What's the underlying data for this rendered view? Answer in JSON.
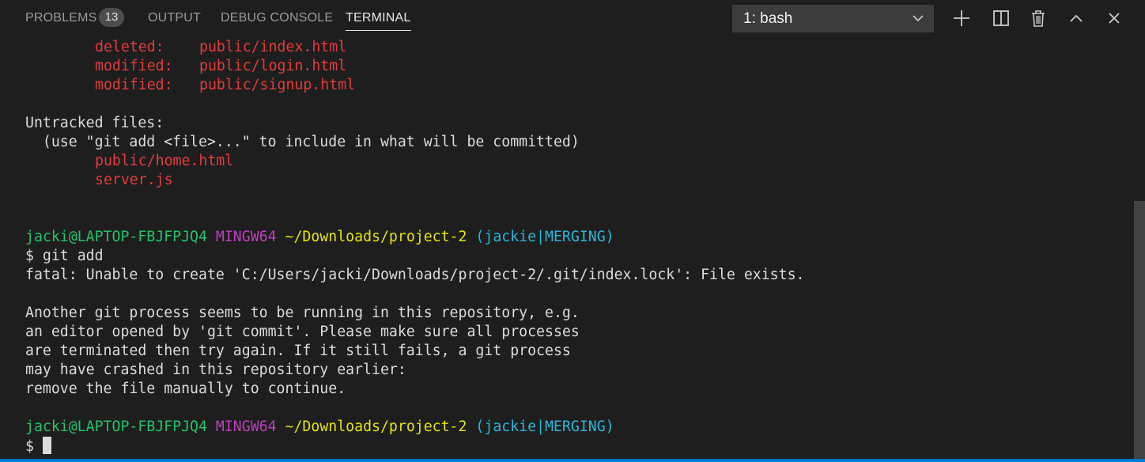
{
  "header": {
    "tabs": [
      {
        "label": "PROBLEMS",
        "active": false
      },
      {
        "label": "OUTPUT",
        "active": false
      },
      {
        "label": "DEBUG CONSOLE",
        "active": false
      },
      {
        "label": "TERMINAL",
        "active": true
      }
    ],
    "problems_count": "13",
    "terminal_select": "1: bash",
    "actions": [
      "plus-icon",
      "split-icon",
      "trash-icon",
      "chevron-up-icon",
      "close-icon"
    ]
  },
  "terminal": {
    "status_lines": [
      {
        "status": "deleted:",
        "file": "public/index.html"
      },
      {
        "status": "modified:",
        "file": "public/login.html"
      },
      {
        "status": "modified:",
        "file": "public/signup.html"
      }
    ],
    "untracked_heading": "Untracked files:",
    "untracked_hint": "  (use \"git add <file>...\" to include in what will be committed)",
    "untracked_files": [
      "public/home.html",
      "server.js"
    ],
    "prompt": {
      "user": "jacki@LAPTOP-FBJFPJQ4",
      "env": "MINGW64",
      "path": "~/Downloads/project-2",
      "branch_open": "(",
      "branch": "jackie",
      "separator": "|",
      "state": "MERGING",
      "branch_close": ")"
    },
    "command": "$ git add",
    "error": "fatal: Unable to create 'C:/Users/jacki/Downloads/project-2/.git/index.lock': File exists.",
    "message_lines": [
      "Another git process seems to be running in this repository, e.g.",
      "an editor opened by 'git commit'. Please make sure all processes",
      "are terminated then try again. If it still fails, a git process",
      "may have crashed in this repository earlier:",
      "remove the file manually to continue."
    ],
    "final_prompt_symbol": "$ "
  }
}
